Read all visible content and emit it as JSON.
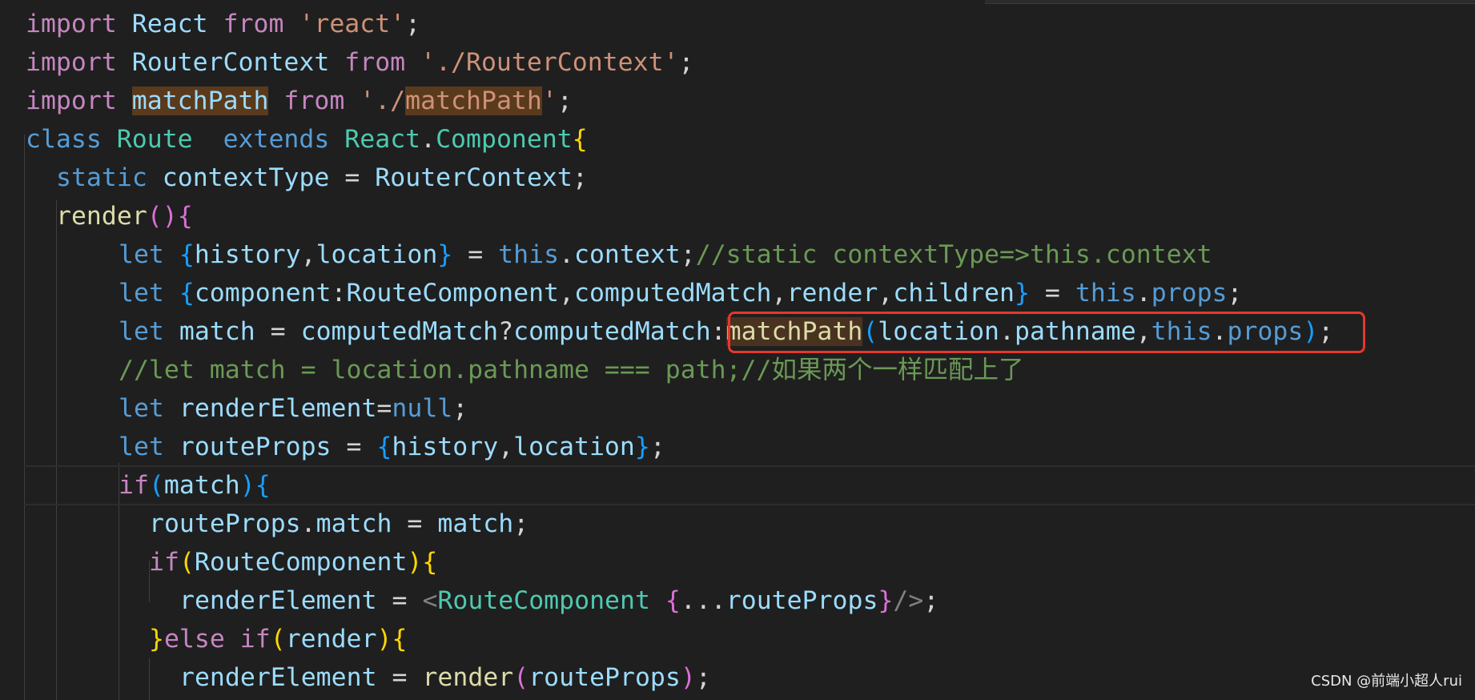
{
  "editor": {
    "colors": {
      "background": "#1f1f1f",
      "keyword": "#c586c0",
      "storage": "#569cd6",
      "class": "#4ec9b0",
      "function": "#dcdcaa",
      "variable": "#9cdcfe",
      "string": "#ce9178",
      "comment": "#6a9955",
      "highlight": "#5a3a1c",
      "annotation_box": "#e5382b"
    },
    "lines": {
      "l1": {
        "t1": "import",
        "t2": "React",
        "t3": "from",
        "t4": "'react'",
        "t5": ";"
      },
      "l2": {
        "t1": "import",
        "t2": "RouterContext",
        "t3": "from",
        "t4": "'./RouterContext'",
        "t5": ";"
      },
      "l3": {
        "t1": "import",
        "t2": "matchPath",
        "t3": "from",
        "t4": "'./",
        "t5": "matchPath",
        "t6": "'",
        "t7": ";"
      },
      "l4": {
        "t1": "class",
        "t2": "Route",
        "t3": "extends",
        "t4": "React",
        "t5": ".",
        "t6": "Component",
        "t7": "{"
      },
      "l5": {
        "t1": "static",
        "t2": "contextType",
        "t3": " = ",
        "t4": "RouterContext",
        "t5": ";"
      },
      "l6": {
        "t1": "render",
        "t2": "()",
        "t3": "{"
      },
      "l7": {
        "t1": "let",
        "t2": "{",
        "t3": "history",
        "t4": ",",
        "t5": "location",
        "t6": "}",
        "t7": " = ",
        "t8": "this",
        "t9": ".",
        "t10": "context",
        "t11": ";",
        "t12": "//static contextType=>this.context"
      },
      "l8": {
        "t1": "let",
        "t2": "{",
        "t3": "component",
        "t4": ":",
        "t5": "RouteComponent",
        "t6": ",",
        "t7": "computedMatch",
        "t8": ",",
        "t9": "render",
        "t10": ",",
        "t11": "children",
        "t12": "}",
        "t13": " = ",
        "t14": "this",
        "t15": ".",
        "t16": "props",
        "t17": ";"
      },
      "l9": {
        "t1": "let",
        "t2": "match",
        "t3": " = ",
        "t4": "computedMatch",
        "t5": "?",
        "t6": "computedMatch",
        "t7": ":",
        "t8": "matchPath",
        "t9": "(",
        "t10": "location",
        "t11": ".",
        "t12": "pathname",
        "t13": ",",
        "t14": "this",
        "t15": ".",
        "t16": "props",
        "t17": ")",
        "t18": ";"
      },
      "l10": {
        "t1": "//let match = location.pathname === path;//如果两个一样匹配上了"
      },
      "l11": {
        "t1": "let",
        "t2": "renderElement",
        "t3": "=",
        "t4": "null",
        "t5": ";"
      },
      "l12": {
        "t1": "let",
        "t2": "routeProps",
        "t3": " = ",
        "t4": "{",
        "t5": "history",
        "t6": ",",
        "t7": "location",
        "t8": "}",
        "t9": ";"
      },
      "l13": {
        "t1": "if",
        "t2": "(",
        "t3": "match",
        "t4": ")",
        "t5": "{"
      },
      "l14": {
        "t1": "routeProps",
        "t2": ".",
        "t3": "match",
        "t4": " = ",
        "t5": "match",
        "t6": ";"
      },
      "l15": {
        "t1": "if",
        "t2": "(",
        "t3": "RouteComponent",
        "t4": ")",
        "t5": "{"
      },
      "l16": {
        "t1": "renderElement",
        "t2": " = ",
        "t3": "<",
        "t4": "RouteComponent",
        "t5": " {",
        "t6": "...",
        "t7": "routeProps",
        "t8": "}",
        "t9": "/>",
        "t10": ";"
      },
      "l17": {
        "t1": "}",
        "t2": "else",
        "t3": "if",
        "t4": "(",
        "t5": "render",
        "t6": ")",
        "t7": "{"
      },
      "l18": {
        "t1": "renderElement",
        "t2": " = ",
        "t3": "render",
        "t4": "(",
        "t5": "routeProps",
        "t6": ")",
        "t7": ";"
      }
    }
  },
  "watermark": {
    "text": "CSDN @前端小超人rui"
  }
}
